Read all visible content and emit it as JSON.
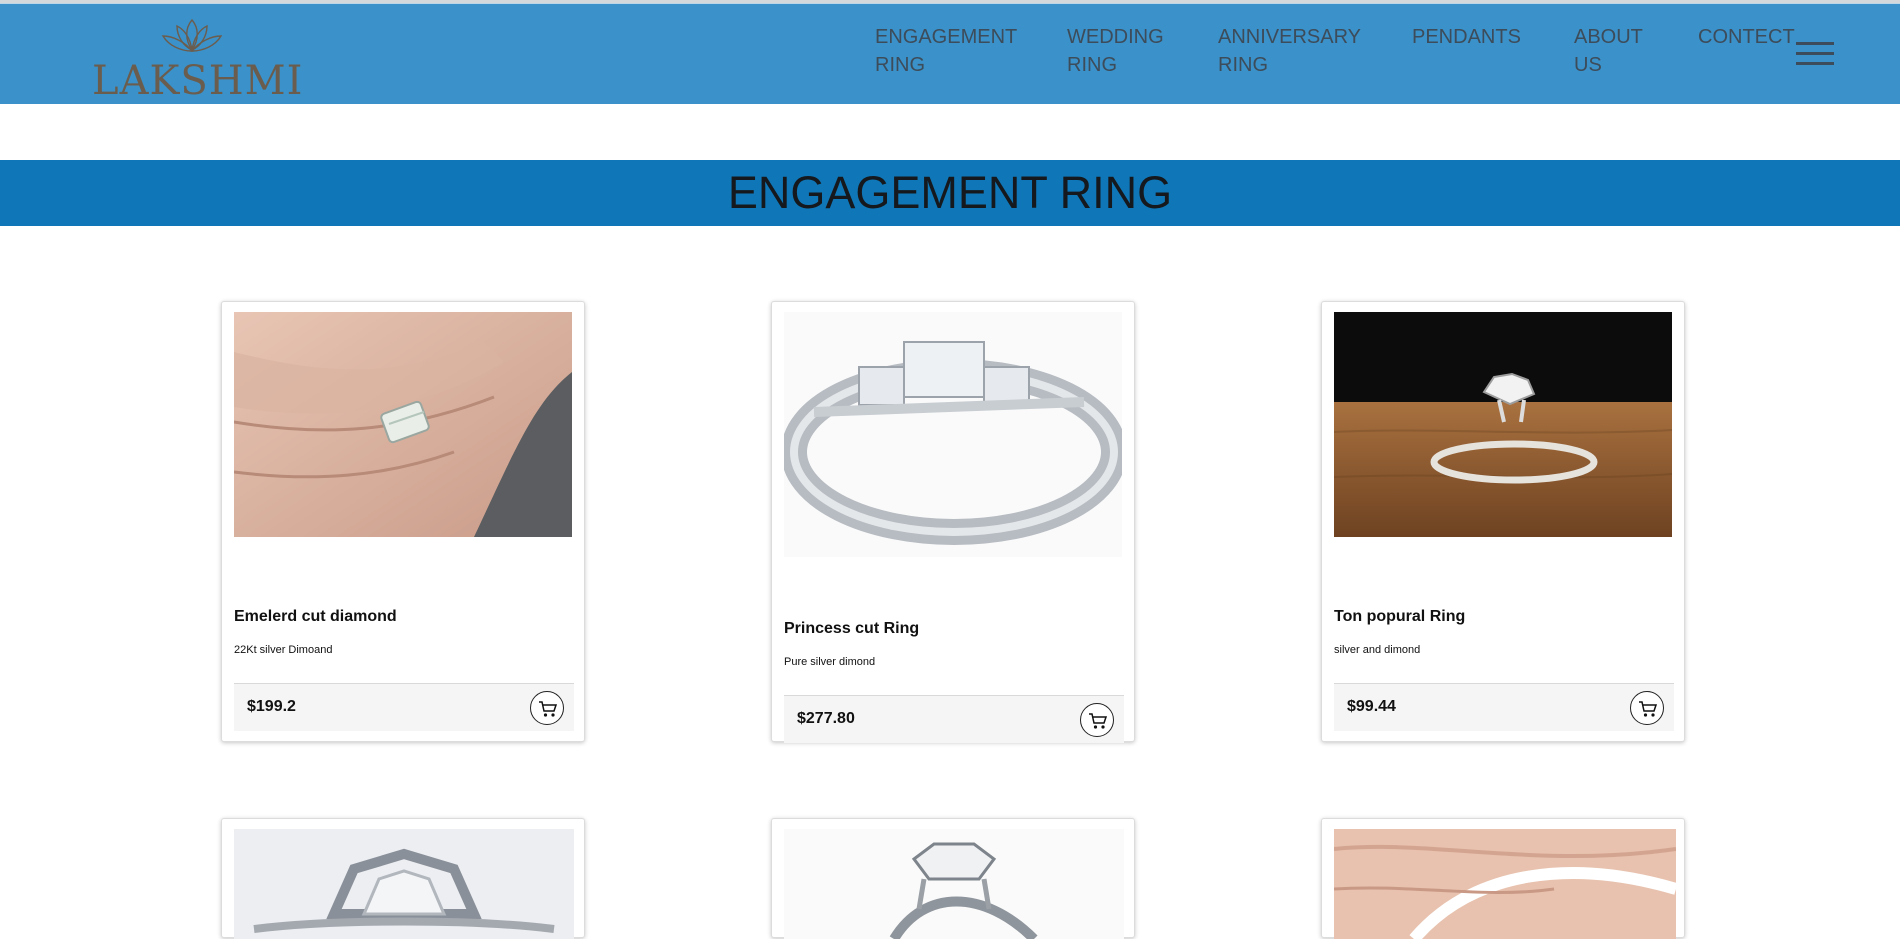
{
  "brand": {
    "name": "LAKSHMI"
  },
  "nav": {
    "items": [
      {
        "label": "ENGAGEMENT RING"
      },
      {
        "label": "WEDDING RING"
      },
      {
        "label": "ANNIVERSARY RING"
      },
      {
        "label": "PENDANTS"
      },
      {
        "label": "ABOUT US"
      },
      {
        "label": "CONTECT"
      }
    ],
    "menu_icon": "hamburger-menu-icon"
  },
  "section": {
    "title": "ENGAGEMENT RING"
  },
  "products": [
    {
      "name": "Emelerd cut diamond",
      "description": "22Kt silver Dimoand",
      "price": "$199.2",
      "image": "ring-on-hand-photo"
    },
    {
      "name": "Princess cut Ring",
      "description": "Pure silver dimond",
      "price": "$277.80",
      "image": "silver-princess-ring-photo"
    },
    {
      "name": "Ton popural Ring",
      "description": "silver and dimond",
      "price": "$99.44",
      "image": "solitaire-ring-on-wood-photo"
    },
    {
      "image": "halo-ring-photo"
    },
    {
      "image": "round-solitaire-ring-photo"
    },
    {
      "image": "ring-on-finger-photo"
    }
  ],
  "colors": {
    "navbar": "#3b91c9",
    "band": "#0f77b8",
    "nav_text": "#3d4c5a"
  },
  "icons": {
    "cart": "shopping-cart-icon"
  }
}
